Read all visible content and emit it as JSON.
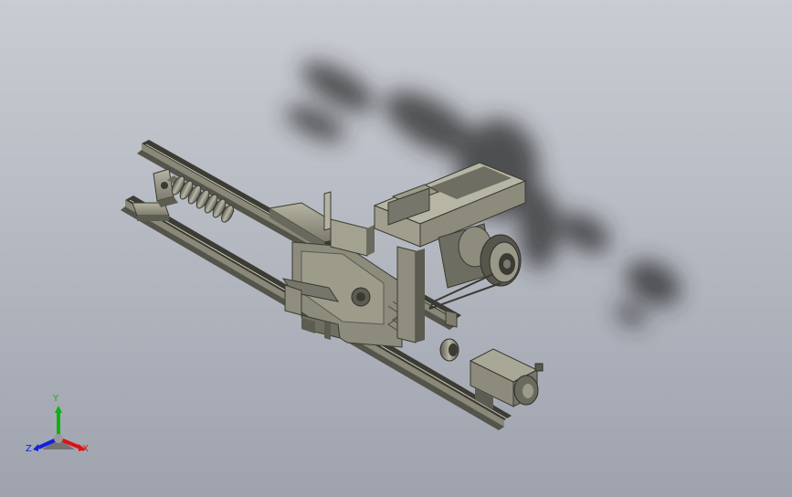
{
  "viewport": {
    "colors": {
      "background_top": "#c9ccd2",
      "background_bottom": "#9ea3ae",
      "metal_light": "#a9a796",
      "metal_mid": "#8c8a7a",
      "metal_dark": "#4a4a42",
      "shadow": "#2c2c2c"
    }
  },
  "triad": {
    "x_label": "X",
    "y_label": "Y",
    "z_label": "Z",
    "x_color": "#e01010",
    "y_color": "#10b010",
    "z_color": "#1020e0"
  },
  "model": {
    "parts": [
      "linear-rail-upper",
      "linear-rail-lower",
      "ball-screw",
      "screw-bearing-block",
      "carriage-plate",
      "motor-mount-bracket",
      "gear-housing",
      "belt-pulley",
      "drive-belt",
      "coupling",
      "servo-motor"
    ]
  }
}
